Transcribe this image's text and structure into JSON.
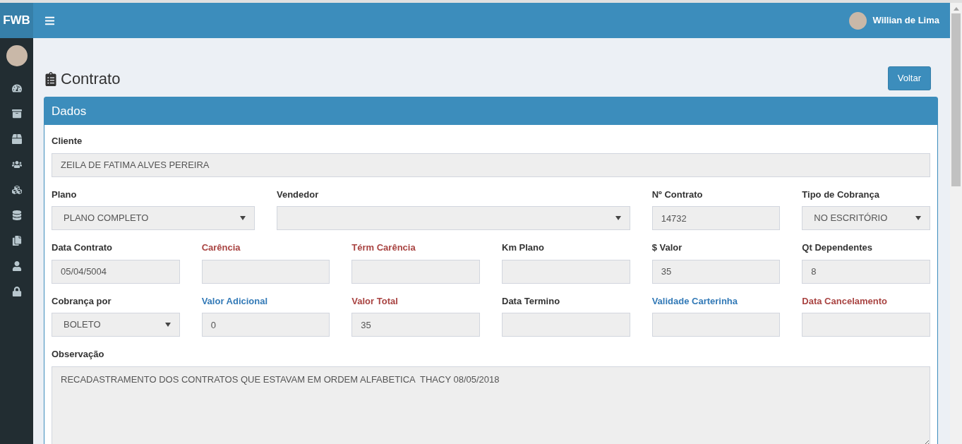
{
  "brand": "FWB",
  "user": {
    "name": "Willian de Lima"
  },
  "page": {
    "title": "Contrato",
    "back_button": "Voltar"
  },
  "panel": {
    "title": "Dados",
    "fields": [
      {
        "label": "Cliente",
        "color": "#333333",
        "kind": "input",
        "value": "ZEILA DE FATIMA ALVES PEREIRA"
      },
      {
        "label": "Plano",
        "color": "#333333",
        "kind": "select",
        "value": "PLANO COMPLETO"
      },
      {
        "label": "Vendedor",
        "color": "#333333",
        "kind": "select"
      },
      {
        "label": "Nº Contrato",
        "color": "#333333",
        "kind": "input",
        "value": "14732"
      },
      {
        "label": "Tipo de Cobrança",
        "color": "#333333",
        "kind": "select",
        "value": "NO ESCRITÓRIO"
      },
      {
        "label": "Data Contrato",
        "color": "#333333",
        "kind": "input",
        "value": "05/04/5004"
      },
      {
        "label": "Carência",
        "color": "#a94442",
        "kind": "input"
      },
      {
        "label": "Térm Carência",
        "color": "#a94442",
        "kind": "input"
      },
      {
        "label": "Km Plano",
        "color": "#333333",
        "kind": "input"
      },
      {
        "label": "$ Valor",
        "color": "#333333",
        "kind": "input",
        "value": "35"
      },
      {
        "label": "Qt Dependentes",
        "color": "#333333",
        "kind": "input",
        "value": "8"
      },
      {
        "label": "Cobrança por",
        "color": "#333333",
        "kind": "select",
        "value": "BOLETO"
      },
      {
        "label": "Valor Adicional",
        "color": "#337ab7",
        "kind": "input",
        "value": "0"
      },
      {
        "label": "Valor Total",
        "color": "#a94442",
        "kind": "input",
        "value": "35"
      },
      {
        "label": "Data Termino",
        "color": "#333333",
        "kind": "input"
      },
      {
        "label": "Validade Carterinha",
        "color": "#337ab7",
        "kind": "input"
      },
      {
        "label": "Data Cancelamento",
        "color": "#a94442",
        "kind": "input"
      },
      {
        "label": "Observação",
        "color": "#333333",
        "kind": "textarea",
        "value": "RECADASTRAMENTO DOS CONTRATOS QUE ESTAVAM EM ORDEM ALFABETICA  THACY 08/05/2018"
      }
    ]
  }
}
